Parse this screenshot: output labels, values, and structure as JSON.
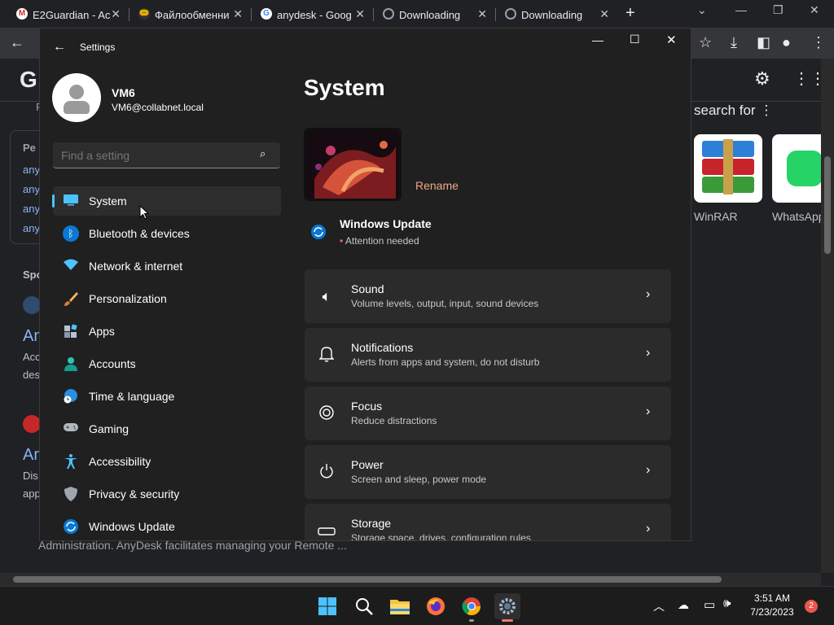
{
  "browser": {
    "tabs": [
      {
        "label": "E2Guardian - Ac",
        "favicon": "gmail-icon",
        "color": "#d93025"
      },
      {
        "label": "Файлообменни",
        "favicon": "fileshare-icon",
        "color": "#e8b400"
      },
      {
        "label": "anydesk - Goog",
        "favicon": "google-icon",
        "color": "#4285f4"
      },
      {
        "label": "Downloading",
        "favicon": "globe-icon",
        "color": "#9aa0a6"
      },
      {
        "label": "Downloading",
        "favicon": "globe-icon",
        "color": "#9aa0a6"
      }
    ],
    "new_tab": "+",
    "bg_page": {
      "search_for_label": "search for",
      "apps": [
        {
          "name": "WinRAR"
        },
        {
          "name": "WhatsApp"
        }
      ],
      "snippets": [
        "Pe",
        "any",
        "any",
        "any",
        "any",
        "Spo",
        "An",
        "Acc",
        "des",
        "An",
        "Dis",
        "app"
      ],
      "footer_text": "Administration. AnyDesk facilitates managing your Remote ...",
      "letter_g": "G",
      "letter_f": "F"
    }
  },
  "settings": {
    "window_title": "Settings",
    "user": {
      "name": "VM6",
      "email": "VM6@collabnet.local"
    },
    "search_placeholder": "Find a setting",
    "nav": [
      {
        "label": "System",
        "icon": "monitor-icon",
        "selected": true
      },
      {
        "label": "Bluetooth & devices",
        "icon": "bluetooth-icon"
      },
      {
        "label": "Network & internet",
        "icon": "wifi-icon"
      },
      {
        "label": "Personalization",
        "icon": "brush-icon"
      },
      {
        "label": "Apps",
        "icon": "apps-icon"
      },
      {
        "label": "Accounts",
        "icon": "account-icon"
      },
      {
        "label": "Time & language",
        "icon": "globe-clock-icon"
      },
      {
        "label": "Gaming",
        "icon": "gamepad-icon"
      },
      {
        "label": "Accessibility",
        "icon": "accessibility-icon"
      },
      {
        "label": "Privacy & security",
        "icon": "shield-icon"
      },
      {
        "label": "Windows Update",
        "icon": "update-icon"
      }
    ],
    "page_title": "System",
    "rename_label": "Rename",
    "update": {
      "title": "Windows Update",
      "status": "Attention needed"
    },
    "cards": [
      {
        "title": "Sound",
        "subtitle": "Volume levels, output, input, sound devices",
        "icon": "speaker-icon"
      },
      {
        "title": "Notifications",
        "subtitle": "Alerts from apps and system, do not disturb",
        "icon": "bell-icon"
      },
      {
        "title": "Focus",
        "subtitle": "Reduce distractions",
        "icon": "focus-icon"
      },
      {
        "title": "Power",
        "subtitle": "Screen and sleep, power mode",
        "icon": "power-icon"
      },
      {
        "title": "Storage",
        "subtitle": "Storage space, drives, configuration rules",
        "icon": "storage-icon"
      }
    ]
  },
  "taskbar": {
    "time": "3:51 AM",
    "date": "7/23/2023",
    "notification_count": "2"
  },
  "colors": {
    "accent": "#4cc2ff",
    "rename": "#f0a78a",
    "window_bg": "#202020",
    "card_bg": "#2b2b2b",
    "attention_dot": "#ff6b6b"
  }
}
